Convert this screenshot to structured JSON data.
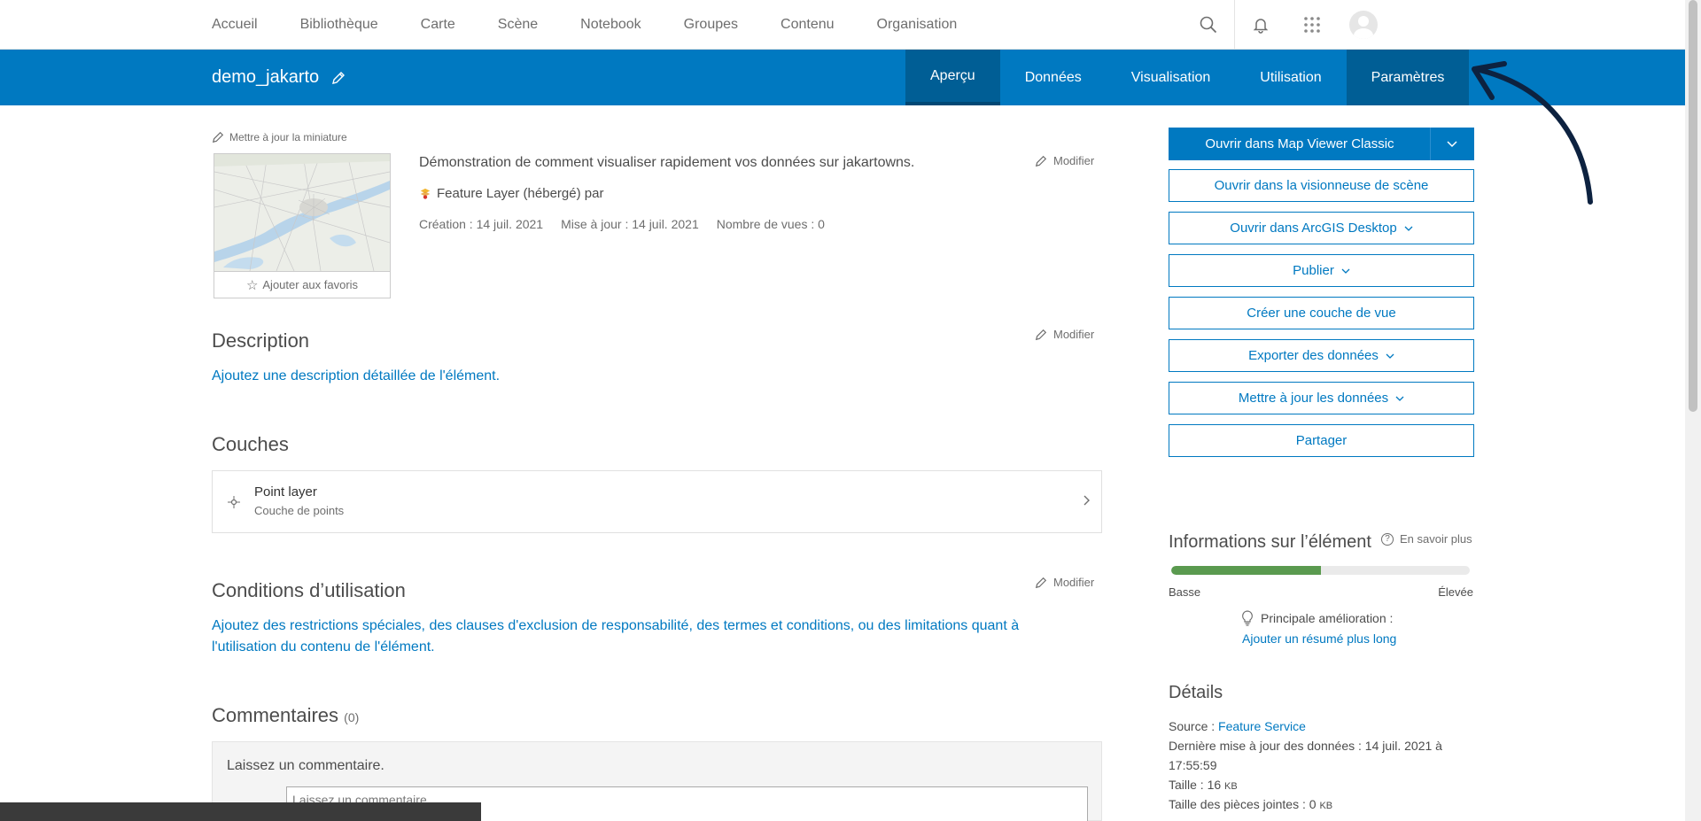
{
  "nav": {
    "items": [
      "Accueil",
      "Bibliothèque",
      "Carte",
      "Scène",
      "Notebook",
      "Groupes",
      "Contenu",
      "Organisation"
    ],
    "icons": [
      "search-icon",
      "bell-icon",
      "apps-grid-icon",
      "avatar"
    ]
  },
  "item": {
    "title": "demo_jakarto",
    "tabs": [
      "Aperçu",
      "Données",
      "Visualisation",
      "Utilisation",
      "Paramètres"
    ],
    "active_tab": "Aperçu"
  },
  "thumbnail": {
    "update_label": "Mettre à jour la miniature",
    "favorite_label": "Ajouter aux favoris"
  },
  "summary": {
    "text": "Démonstration de comment visualiser rapidement vos données sur jakartowns.",
    "type": "Feature Layer (hébergé) par",
    "created": "Création : 14 juil. 2021",
    "updated": "Mise à jour : 14 juil. 2021",
    "views": "Nombre de vues : 0",
    "modify_label": "Modifier"
  },
  "description": {
    "title": "Description",
    "link": "Ajoutez une description détaillée de l'élément.",
    "modify_label": "Modifier"
  },
  "layers": {
    "title": "Couches",
    "items": [
      {
        "name": "Point layer",
        "type": "Couche de points"
      }
    ]
  },
  "terms": {
    "title": "Conditions d’utilisation",
    "link": "Ajoutez des restrictions spéciales, des clauses d'exclusion de responsabilité, des termes et conditions, ou des limitations quant à l'utilisation du contenu de l'élément.",
    "modify_label": "Modifier"
  },
  "comments": {
    "title": "Commentaires",
    "count": "(0)",
    "prompt": "Laissez un commentaire.",
    "placeholder": "Laissez un commentaire."
  },
  "actions": {
    "primary": "Ouvrir dans Map Viewer Classic",
    "buttons": [
      {
        "label": "Ouvrir dans la visionneuse de scène",
        "dropdown": false
      },
      {
        "label": "Ouvrir dans ArcGIS Desktop",
        "dropdown": true
      },
      {
        "label": "Publier",
        "dropdown": true
      },
      {
        "label": "Créer une couche de vue",
        "dropdown": false
      },
      {
        "label": "Exporter des données",
        "dropdown": true
      },
      {
        "label": "Mettre à jour les données",
        "dropdown": true
      },
      {
        "label": "Partager",
        "dropdown": false
      }
    ]
  },
  "item_info": {
    "title": "Informations sur l’élément",
    "learn_more": "En savoir plus",
    "score_fraction": 0.5,
    "low": "Basse",
    "high": "Élevée",
    "improvement_label": "Principale amélioration :",
    "improvement_link": "Ajouter un résumé plus long"
  },
  "details": {
    "title": "Détails",
    "source_label": "Source :",
    "source_value": "Feature Service",
    "last_update": "Dernière mise à jour des données : 14 juil. 2021 à 17:55:59",
    "size_label": "Taille : 16",
    "size_unit": "KB",
    "attach_label": "Taille des pièces jointes : 0",
    "attach_unit": "KB"
  },
  "colors": {
    "brand_blue": "#0079c1",
    "active_tab": "#005e95",
    "score_green": "#5a9a4f",
    "annotation_arrow": "#0d2240"
  }
}
